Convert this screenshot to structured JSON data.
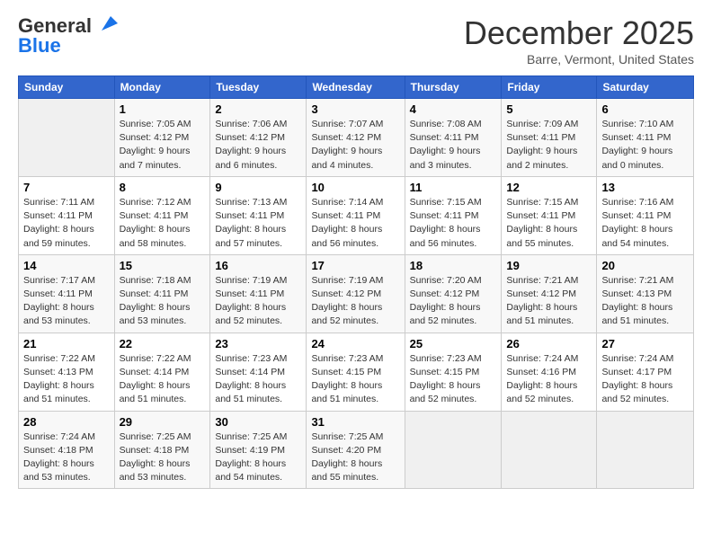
{
  "header": {
    "logo_line1": "General",
    "logo_line2": "Blue",
    "month": "December 2025",
    "location": "Barre, Vermont, United States"
  },
  "days_of_week": [
    "Sunday",
    "Monday",
    "Tuesday",
    "Wednesday",
    "Thursday",
    "Friday",
    "Saturday"
  ],
  "weeks": [
    [
      {
        "day": "",
        "sunrise": "",
        "sunset": "",
        "daylight": ""
      },
      {
        "day": "1",
        "sunrise": "Sunrise: 7:05 AM",
        "sunset": "Sunset: 4:12 PM",
        "daylight": "Daylight: 9 hours and 7 minutes."
      },
      {
        "day": "2",
        "sunrise": "Sunrise: 7:06 AM",
        "sunset": "Sunset: 4:12 PM",
        "daylight": "Daylight: 9 hours and 6 minutes."
      },
      {
        "day": "3",
        "sunrise": "Sunrise: 7:07 AM",
        "sunset": "Sunset: 4:12 PM",
        "daylight": "Daylight: 9 hours and 4 minutes."
      },
      {
        "day": "4",
        "sunrise": "Sunrise: 7:08 AM",
        "sunset": "Sunset: 4:11 PM",
        "daylight": "Daylight: 9 hours and 3 minutes."
      },
      {
        "day": "5",
        "sunrise": "Sunrise: 7:09 AM",
        "sunset": "Sunset: 4:11 PM",
        "daylight": "Daylight: 9 hours and 2 minutes."
      },
      {
        "day": "6",
        "sunrise": "Sunrise: 7:10 AM",
        "sunset": "Sunset: 4:11 PM",
        "daylight": "Daylight: 9 hours and 0 minutes."
      }
    ],
    [
      {
        "day": "7",
        "sunrise": "Sunrise: 7:11 AM",
        "sunset": "Sunset: 4:11 PM",
        "daylight": "Daylight: 8 hours and 59 minutes."
      },
      {
        "day": "8",
        "sunrise": "Sunrise: 7:12 AM",
        "sunset": "Sunset: 4:11 PM",
        "daylight": "Daylight: 8 hours and 58 minutes."
      },
      {
        "day": "9",
        "sunrise": "Sunrise: 7:13 AM",
        "sunset": "Sunset: 4:11 PM",
        "daylight": "Daylight: 8 hours and 57 minutes."
      },
      {
        "day": "10",
        "sunrise": "Sunrise: 7:14 AM",
        "sunset": "Sunset: 4:11 PM",
        "daylight": "Daylight: 8 hours and 56 minutes."
      },
      {
        "day": "11",
        "sunrise": "Sunrise: 7:15 AM",
        "sunset": "Sunset: 4:11 PM",
        "daylight": "Daylight: 8 hours and 56 minutes."
      },
      {
        "day": "12",
        "sunrise": "Sunrise: 7:15 AM",
        "sunset": "Sunset: 4:11 PM",
        "daylight": "Daylight: 8 hours and 55 minutes."
      },
      {
        "day": "13",
        "sunrise": "Sunrise: 7:16 AM",
        "sunset": "Sunset: 4:11 PM",
        "daylight": "Daylight: 8 hours and 54 minutes."
      }
    ],
    [
      {
        "day": "14",
        "sunrise": "Sunrise: 7:17 AM",
        "sunset": "Sunset: 4:11 PM",
        "daylight": "Daylight: 8 hours and 53 minutes."
      },
      {
        "day": "15",
        "sunrise": "Sunrise: 7:18 AM",
        "sunset": "Sunset: 4:11 PM",
        "daylight": "Daylight: 8 hours and 53 minutes."
      },
      {
        "day": "16",
        "sunrise": "Sunrise: 7:19 AM",
        "sunset": "Sunset: 4:11 PM",
        "daylight": "Daylight: 8 hours and 52 minutes."
      },
      {
        "day": "17",
        "sunrise": "Sunrise: 7:19 AM",
        "sunset": "Sunset: 4:12 PM",
        "daylight": "Daylight: 8 hours and 52 minutes."
      },
      {
        "day": "18",
        "sunrise": "Sunrise: 7:20 AM",
        "sunset": "Sunset: 4:12 PM",
        "daylight": "Daylight: 8 hours and 52 minutes."
      },
      {
        "day": "19",
        "sunrise": "Sunrise: 7:21 AM",
        "sunset": "Sunset: 4:12 PM",
        "daylight": "Daylight: 8 hours and 51 minutes."
      },
      {
        "day": "20",
        "sunrise": "Sunrise: 7:21 AM",
        "sunset": "Sunset: 4:13 PM",
        "daylight": "Daylight: 8 hours and 51 minutes."
      }
    ],
    [
      {
        "day": "21",
        "sunrise": "Sunrise: 7:22 AM",
        "sunset": "Sunset: 4:13 PM",
        "daylight": "Daylight: 8 hours and 51 minutes."
      },
      {
        "day": "22",
        "sunrise": "Sunrise: 7:22 AM",
        "sunset": "Sunset: 4:14 PM",
        "daylight": "Daylight: 8 hours and 51 minutes."
      },
      {
        "day": "23",
        "sunrise": "Sunrise: 7:23 AM",
        "sunset": "Sunset: 4:14 PM",
        "daylight": "Daylight: 8 hours and 51 minutes."
      },
      {
        "day": "24",
        "sunrise": "Sunrise: 7:23 AM",
        "sunset": "Sunset: 4:15 PM",
        "daylight": "Daylight: 8 hours and 51 minutes."
      },
      {
        "day": "25",
        "sunrise": "Sunrise: 7:23 AM",
        "sunset": "Sunset: 4:15 PM",
        "daylight": "Daylight: 8 hours and 52 minutes."
      },
      {
        "day": "26",
        "sunrise": "Sunrise: 7:24 AM",
        "sunset": "Sunset: 4:16 PM",
        "daylight": "Daylight: 8 hours and 52 minutes."
      },
      {
        "day": "27",
        "sunrise": "Sunrise: 7:24 AM",
        "sunset": "Sunset: 4:17 PM",
        "daylight": "Daylight: 8 hours and 52 minutes."
      }
    ],
    [
      {
        "day": "28",
        "sunrise": "Sunrise: 7:24 AM",
        "sunset": "Sunset: 4:18 PM",
        "daylight": "Daylight: 8 hours and 53 minutes."
      },
      {
        "day": "29",
        "sunrise": "Sunrise: 7:25 AM",
        "sunset": "Sunset: 4:18 PM",
        "daylight": "Daylight: 8 hours and 53 minutes."
      },
      {
        "day": "30",
        "sunrise": "Sunrise: 7:25 AM",
        "sunset": "Sunset: 4:19 PM",
        "daylight": "Daylight: 8 hours and 54 minutes."
      },
      {
        "day": "31",
        "sunrise": "Sunrise: 7:25 AM",
        "sunset": "Sunset: 4:20 PM",
        "daylight": "Daylight: 8 hours and 55 minutes."
      },
      {
        "day": "",
        "sunrise": "",
        "sunset": "",
        "daylight": ""
      },
      {
        "day": "",
        "sunrise": "",
        "sunset": "",
        "daylight": ""
      },
      {
        "day": "",
        "sunrise": "",
        "sunset": "",
        "daylight": ""
      }
    ]
  ]
}
